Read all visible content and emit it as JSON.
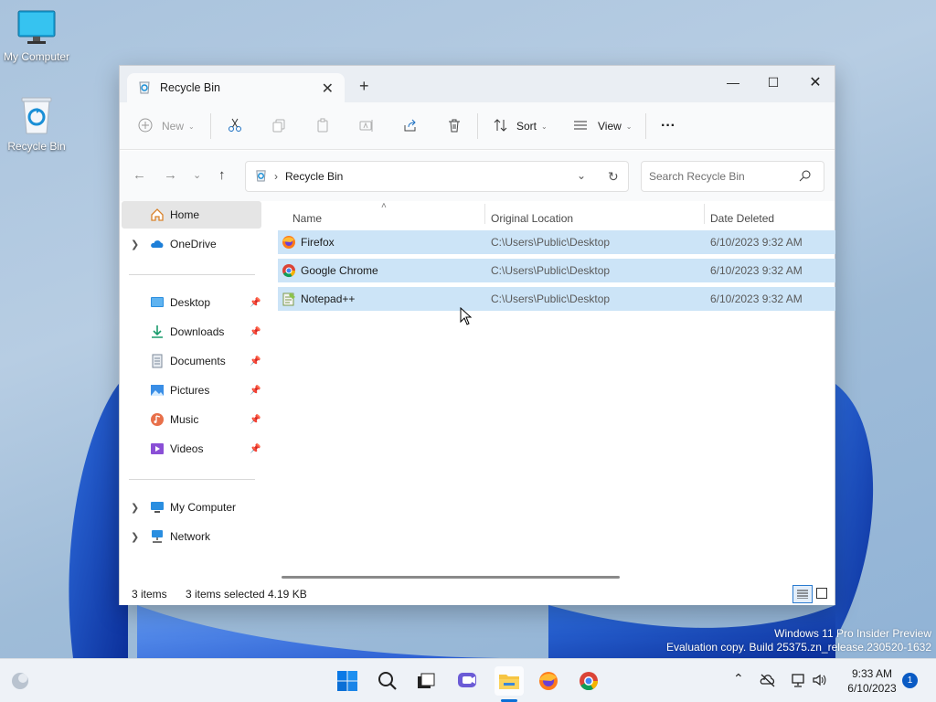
{
  "desktop": {
    "icons": [
      {
        "label": "My Computer"
      },
      {
        "label": "Recycle Bin"
      }
    ]
  },
  "window": {
    "tab_title": "Recycle Bin",
    "tab_close": "✕",
    "new_tab": "+",
    "minimize": "—",
    "maximize": "☐",
    "close": "✕"
  },
  "toolbar": {
    "new_label": "New",
    "sort_label": "Sort",
    "view_label": "View",
    "more_label": "···"
  },
  "address": {
    "path": "Recycle Bin",
    "search_placeholder": "Search Recycle Bin"
  },
  "sidebar": {
    "home": "Home",
    "onedrive": "OneDrive",
    "quick": [
      {
        "label": "Desktop"
      },
      {
        "label": "Downloads"
      },
      {
        "label": "Documents"
      },
      {
        "label": "Pictures"
      },
      {
        "label": "Music"
      },
      {
        "label": "Videos"
      }
    ],
    "my_computer": "My Computer",
    "network": "Network"
  },
  "columns": {
    "name": "Name",
    "original_location": "Original Location",
    "date_deleted": "Date Deleted"
  },
  "files": [
    {
      "name": "Firefox",
      "location": "C:\\Users\\Public\\Desktop",
      "date": "6/10/2023 9:32 AM"
    },
    {
      "name": "Google Chrome",
      "location": "C:\\Users\\Public\\Desktop",
      "date": "6/10/2023 9:32 AM"
    },
    {
      "name": "Notepad++",
      "location": "C:\\Users\\Public\\Desktop",
      "date": "6/10/2023 9:32 AM"
    }
  ],
  "status": {
    "count": "3 items",
    "selected": "3 items selected",
    "size": "4.19 KB"
  },
  "watermark": {
    "line1": "Windows 11 Pro Insider Preview",
    "line2": "Evaluation copy. Build 25375.zn_release.230520-1632"
  },
  "taskbar": {
    "time": "9:33 AM",
    "date": "6/10/2023",
    "notifications": "1"
  }
}
